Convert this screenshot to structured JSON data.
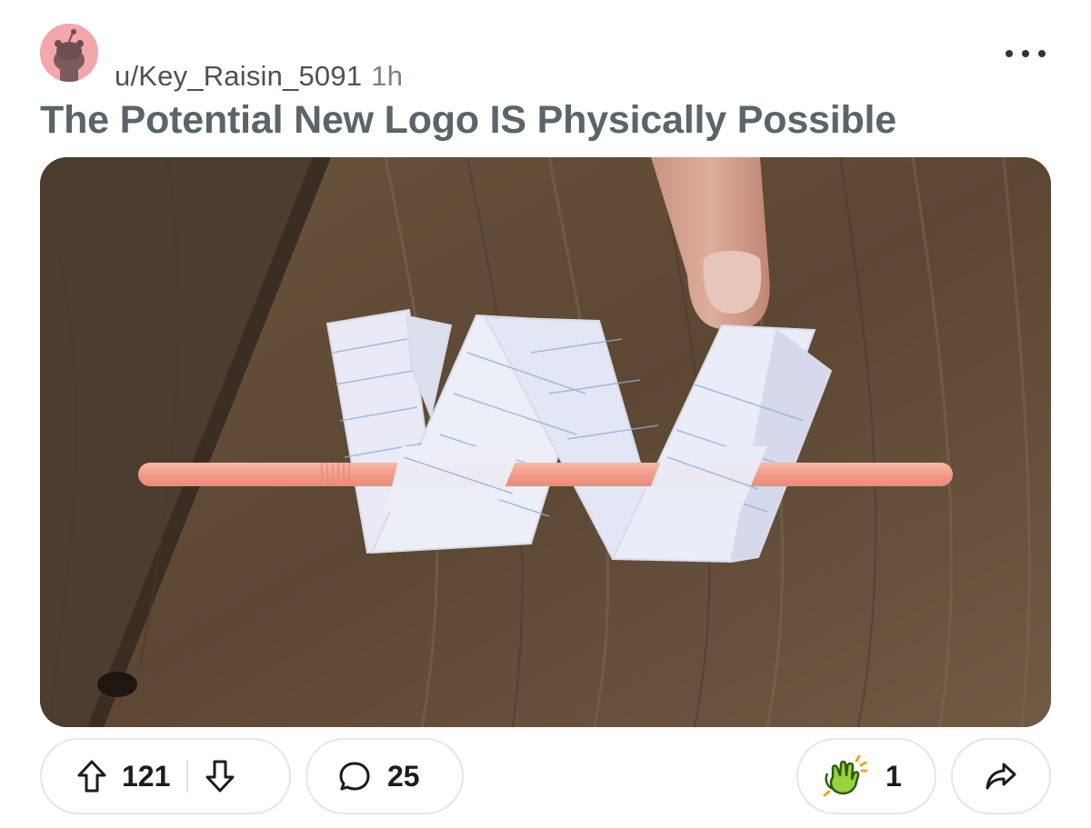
{
  "post": {
    "author": "u/Key_Raisin_5091",
    "time": "1h",
    "title": "The Potential New Logo IS Physically Possible"
  },
  "actions": {
    "upvotes": "121",
    "comments": "25",
    "awards": "1"
  },
  "icons": {
    "avatar": "reddit-snoo-avatar",
    "more": "more-horizontal-icon",
    "upvote": "arrow-up-icon",
    "downvote": "arrow-down-icon",
    "comment": "speech-bubble-icon",
    "award": "clapping-hands-icon",
    "share": "share-arrow-icon"
  },
  "colors": {
    "title": "#5b6469",
    "avatar_bg": "#f2a7ad",
    "pill_border": "#e4e6e8"
  }
}
